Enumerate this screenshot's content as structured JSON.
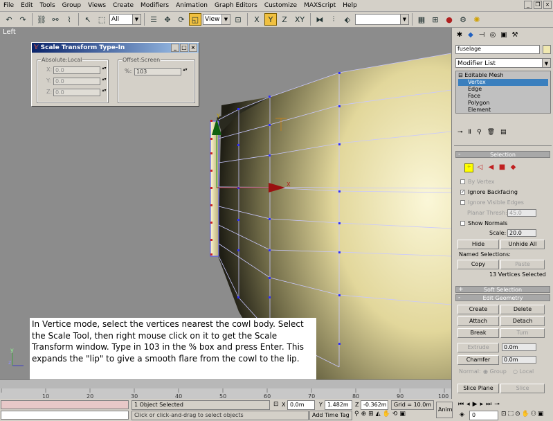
{
  "menu": [
    "File",
    "Edit",
    "Tools",
    "Group",
    "Views",
    "Create",
    "Modifiers",
    "Animation",
    "Graph Editors",
    "Customize",
    "MAXScript",
    "Help"
  ],
  "toolbar": {
    "selection_filter": "All",
    "ref_coord": "View",
    "axis_x": "X",
    "axis_y": "Y",
    "axis_z": "Z",
    "axis_xy": "XY"
  },
  "viewport": {
    "label": "Left",
    "gizmo_y": "Y",
    "gizmo_x": "X",
    "axis_tripod_y": "y",
    "axis_tripod_z": "z"
  },
  "dialog": {
    "title": "Scale Transform Type-In",
    "absolute_group": "Absolute:Local",
    "offset_group": "Offset:Screen",
    "x_label": "X:",
    "y_label": "Y:",
    "z_label": "Z:",
    "x_value": "0.0",
    "y_value": "0.0",
    "z_value": "0.0",
    "percent_label": "%:",
    "percent_value": "103"
  },
  "instruction": "In Vertice mode, select the vertices nearest the cowl body. Select the Scale Tool, then right mouse click on it to get the Scale Transform window.  Type in 103 in the % box and press Enter.  This expands the \"lip\" to give a smooth flare from the cowl to the lip.",
  "panel": {
    "object_name": "fuselage",
    "modifier_list": "Modifier List",
    "stack": [
      "Editable Mesh",
      "Vertex",
      "Edge",
      "Face",
      "Polygon",
      "Element"
    ],
    "selection_rollout": "Selection",
    "by_vertex": "By Vertex",
    "ignore_backfacing": "Ignore Backfacing",
    "ignore_visible_edges": "Ignore Visible Edges",
    "planar_thresh_label": "Planar Thresh:",
    "planar_thresh_value": "45.0",
    "show_normals": "Show Normals",
    "scale_label": "Scale:",
    "scale_value": "20.0",
    "hide": "Hide",
    "unhide_all": "Unhide All",
    "named_selections": "Named Selections:",
    "copy": "Copy",
    "paste": "Paste",
    "selected_count": "13 Vertices Selected",
    "soft_selection": "Soft Selection",
    "edit_geometry": "Edit Geometry",
    "create": "Create",
    "delete": "Delete",
    "attach": "Attach",
    "detach": "Detach",
    "break": "Break",
    "turn": "Turn",
    "extrude": "Extrude",
    "extrude_value": "0.0m",
    "chamfer": "Chamfer",
    "chamfer_value": "0.0m",
    "normal_label": "Normal:",
    "normal_group": "Group",
    "normal_local": "Local",
    "slice_plane": "Slice Plane",
    "slice": "Slice"
  },
  "timeline": {
    "ticks": [
      "10",
      "20",
      "30",
      "40",
      "50",
      "60",
      "70",
      "80",
      "90",
      "100"
    ]
  },
  "status": {
    "selected": "1 Object Selected",
    "prompt": "Click or click-and-drag to select objects",
    "x_label": "X",
    "x_value": "0.0m",
    "y_label": "Y",
    "y_value": "1.482m",
    "z_label": "Z",
    "z_value": "-0.362m",
    "grid": "Grid = 10.0m",
    "add_time_tag": "Add Time Tag",
    "anim": "Anim",
    "frame": "0"
  },
  "colors": {
    "selection_yellow": "#ffff00",
    "vertex_blue": "#3030ff",
    "selected_red": "#cc2020",
    "viewport_bg": "#8c8c8c",
    "stack_highlight": "#3a7fbe"
  }
}
